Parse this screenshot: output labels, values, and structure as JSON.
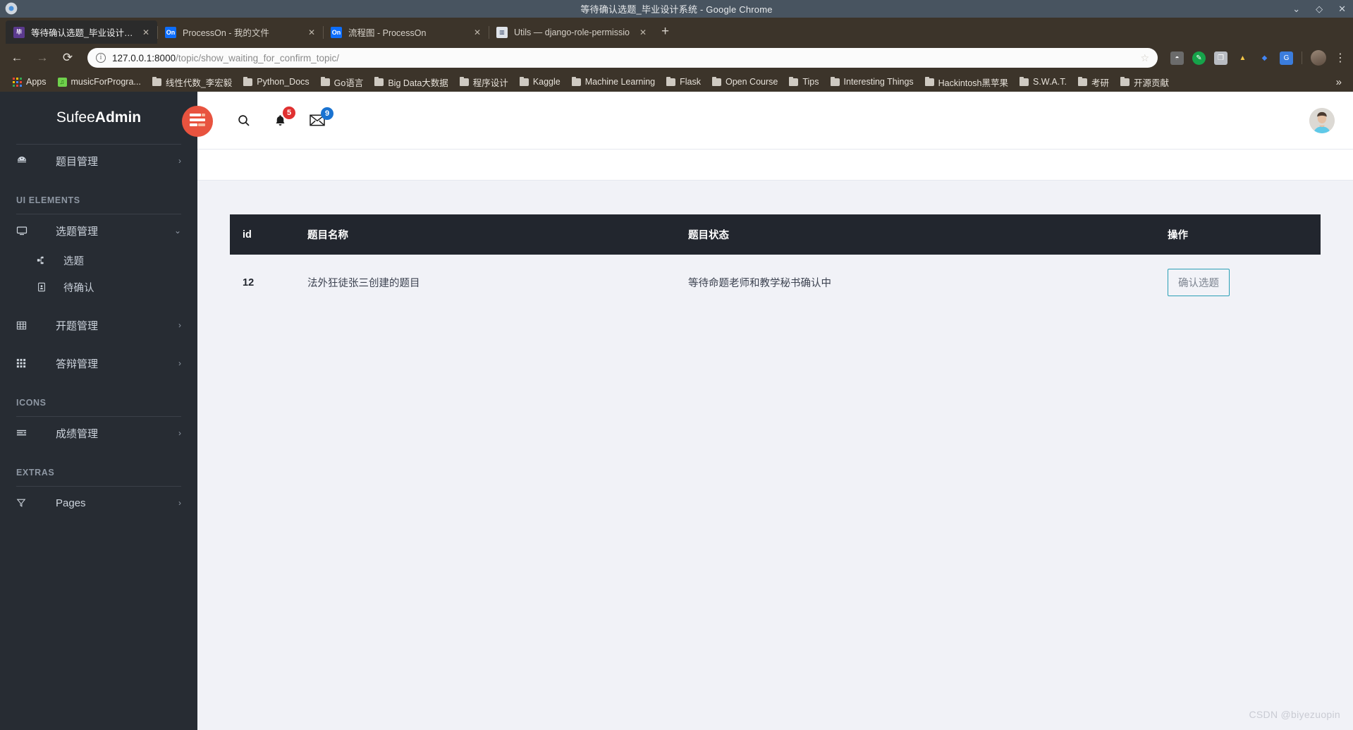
{
  "window": {
    "title": "等待确认选题_毕业设计系统 - Google Chrome",
    "controls": {
      "minimize": "⌄",
      "maximize": "◇",
      "close": "✕"
    }
  },
  "tabs": [
    {
      "label": "等待确认选题_毕业设计系统",
      "favicon": "site-favicon",
      "close": "✕",
      "active": true
    },
    {
      "label": "ProcessOn - 我的文件",
      "favicon": "processon-favicon",
      "close": "✕",
      "active": false
    },
    {
      "label": "流程图 - ProcessOn",
      "favicon": "processon-favicon",
      "close": "✕",
      "active": false
    },
    {
      "label": "Utils — django-role-permissio",
      "favicon": "pycharm-favicon",
      "close": "✕",
      "active": false
    }
  ],
  "new_tab_label": "+",
  "toolbar": {
    "back": "←",
    "forward": "→",
    "reload": "⟳",
    "info_icon": "i",
    "url_host": "127.0.0.1:8000",
    "url_path": "/topic/show_waiting_for_confirm_topic/",
    "star": "☆",
    "menu": "⋮",
    "extensions": [
      "keep-icon",
      "translate-icon",
      "copy-icon",
      "drive-icon",
      "meet-icon",
      "gtranslate-icon"
    ]
  },
  "bookmarks": {
    "apps_label": "Apps",
    "items": [
      {
        "label": "musicForProgra...",
        "icon": "music-icon"
      },
      {
        "label": "线性代数_李宏毅",
        "icon": "folder-icon"
      },
      {
        "label": "Python_Docs",
        "icon": "folder-icon"
      },
      {
        "label": "Go语言",
        "icon": "folder-icon"
      },
      {
        "label": "Big Data大数据",
        "icon": "folder-icon"
      },
      {
        "label": "程序设计",
        "icon": "folder-icon"
      },
      {
        "label": "Kaggle",
        "icon": "folder-icon"
      },
      {
        "label": "Machine Learning",
        "icon": "folder-icon"
      },
      {
        "label": "Flask",
        "icon": "folder-icon"
      },
      {
        "label": "Open Course",
        "icon": "folder-icon"
      },
      {
        "label": "Tips",
        "icon": "folder-icon"
      },
      {
        "label": "Interesting Things",
        "icon": "folder-icon"
      },
      {
        "label": "Hackintosh黑苹果",
        "icon": "folder-icon"
      },
      {
        "label": "S.W.A.T.",
        "icon": "folder-icon"
      },
      {
        "label": "考研",
        "icon": "folder-icon"
      },
      {
        "label": "开源贡献",
        "icon": "folder-icon"
      }
    ],
    "overflow": "»"
  },
  "sidebar": {
    "brand_light": "Sufee ",
    "brand_bold": "Admin",
    "groups": [
      {
        "title": null,
        "items": [
          {
            "label": "题目管理",
            "icon": "dashboard-icon",
            "caret": "›"
          }
        ]
      },
      {
        "title": "UI ELEMENTS",
        "items": [
          {
            "label": "选题管理",
            "icon": "monitor-icon",
            "caret": "⌄",
            "children": [
              {
                "label": "选题",
                "icon": "sitemap-icon"
              },
              {
                "label": "待确认",
                "icon": "id-card-icon"
              }
            ]
          },
          {
            "label": "开题管理",
            "icon": "table-icon",
            "caret": "›"
          },
          {
            "label": "答辩管理",
            "icon": "grid-icon",
            "caret": "›"
          }
        ]
      },
      {
        "title": "ICONS",
        "items": [
          {
            "label": "成绩管理",
            "icon": "align-icon",
            "caret": "›"
          }
        ]
      },
      {
        "title": "EXTRAS",
        "items": [
          {
            "label": "Pages",
            "icon": "filter-icon",
            "caret": "›"
          }
        ]
      }
    ]
  },
  "navbar": {
    "hamburger_icon": "menu-list-icon",
    "search_icon": "search-icon",
    "bell_icon": "bell-icon",
    "bell_badge": "5",
    "mail_icon": "envelope-icon",
    "mail_badge": "9",
    "avatar": "user-avatar"
  },
  "colors": {
    "sidebar_bg": "#272c33",
    "accent_red": "#e8533f",
    "table_header_bg": "#22262e",
    "button_border": "#2a9fb5",
    "badge_red": "#e03131",
    "badge_blue": "#1a73d1",
    "content_bg": "#f1f2f7"
  },
  "table": {
    "columns": [
      "id",
      "题目名称",
      "题目状态",
      "操作"
    ],
    "rows": [
      {
        "id": "12",
        "name": "法外狂徒张三创建的题目",
        "status": "等待命题老师和教学秘书确认中",
        "action_label": "确认选题"
      }
    ]
  },
  "watermark": "CSDN @biyezuopin"
}
